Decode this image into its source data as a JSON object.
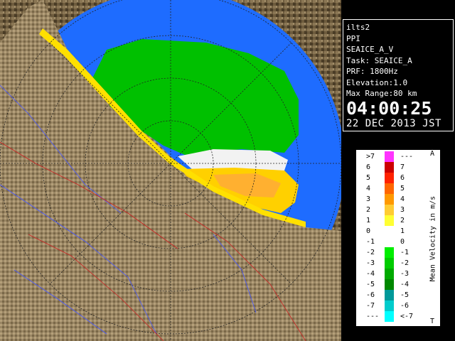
{
  "info": {
    "site": "ilts2",
    "mode": "PPI",
    "product": "SEAICE_A_V",
    "task": "Task: SEAICE_A",
    "prf": "PRF: 1800Hz",
    "elevation": "Elevation:1.0",
    "max_range": "Max Range:80 km",
    "time": "04:00:25",
    "date": "22 DEC 2013 JST"
  },
  "legend": {
    "title": "Mean Velocity in m/s",
    "top_marker": "A",
    "bottom_marker": "T",
    "rows": [
      {
        "lo": ">7",
        "hi": "---",
        "color": "#ff33ff"
      },
      {
        "lo": "6",
        "hi": "7",
        "color": "#cc0000"
      },
      {
        "lo": "5",
        "hi": "6",
        "color": "#ff2200"
      },
      {
        "lo": "4",
        "hi": "5",
        "color": "#ff6600"
      },
      {
        "lo": "3",
        "hi": "4",
        "color": "#ff9900"
      },
      {
        "lo": "2",
        "hi": "3",
        "color": "#ffcc33"
      },
      {
        "lo": "1",
        "hi": "2",
        "color": "#ffff33"
      },
      {
        "lo": "0",
        "hi": "1",
        "color": "#ffffff"
      },
      {
        "lo": "-1",
        "hi": "0",
        "color": "#ffffff"
      },
      {
        "lo": "-2",
        "hi": "-1",
        "color": "#00ee00"
      },
      {
        "lo": "-3",
        "hi": "-2",
        "color": "#00cc00"
      },
      {
        "lo": "-4",
        "hi": "-3",
        "color": "#00aa00"
      },
      {
        "lo": "-5",
        "hi": "-4",
        "color": "#008800"
      },
      {
        "lo": "-6",
        "hi": "-5",
        "color": "#009999"
      },
      {
        "lo": "-7",
        "hi": "-6",
        "color": "#00cccc"
      },
      {
        "lo": "---",
        "hi": "<-7",
        "color": "#00ffff"
      }
    ]
  },
  "colors": {
    "sea": "#1e6cff",
    "land": "#7a6a4a",
    "green_echo": "#00bb00",
    "yellow_echo": "#ffd400"
  }
}
